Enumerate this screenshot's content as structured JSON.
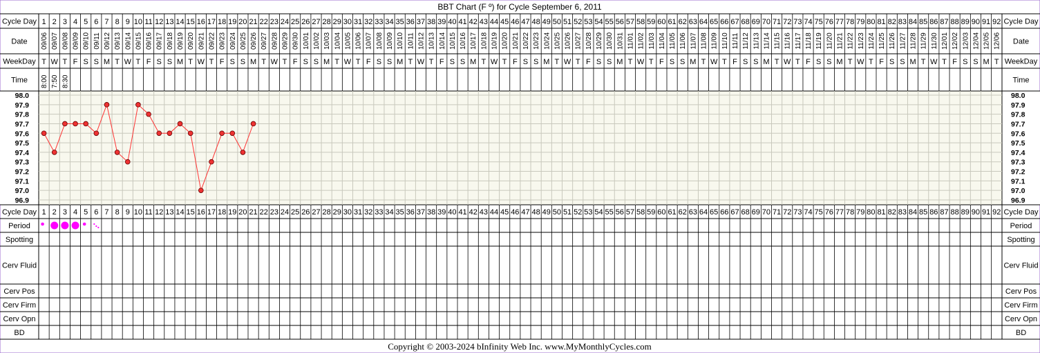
{
  "title": "BBT Chart (F º) for Cycle September 6, 2011",
  "row_labels": {
    "cycle_day": "Cycle Day",
    "date": "Date",
    "weekday": "WeekDay",
    "time": "Time",
    "period": "Period",
    "spotting": "Spotting",
    "cerv_fluid": "Cerv Fluid",
    "cerv_pos": "Cerv Pos",
    "cerv_firm": "Cerv Firm",
    "cerv_opn": "Cerv Opn",
    "bd": "BD"
  },
  "start_date": "2011-09-06",
  "num_days": 92,
  "weekday_letters": [
    "S",
    "M",
    "T",
    "W",
    "T",
    "F",
    "S"
  ],
  "times": [
    "8:00",
    "7:50",
    "8:30"
  ],
  "footer": "Copyright © 2003-2024 bInfinity Web Inc.      www.MyMonthlyCycles.com",
  "colors": {
    "border": "#9966cc",
    "line": "#ff3333",
    "point_fill": "#ee3333",
    "period": "#ff00ff",
    "grid_bg": "#f8f8ee",
    "header_bg": "#f0e6f8"
  },
  "chart_data": {
    "type": "line",
    "x_label": "Cycle Day",
    "y_ticks": [
      "98.0",
      "97.9",
      "97.8",
      "97.7",
      "97.6",
      "97.5",
      "97.4",
      "97.3",
      "97.2",
      "97.1",
      "97.0",
      "96.9"
    ],
    "ylim": [
      96.9,
      98.0
    ],
    "series": [
      {
        "x": [
          1,
          2,
          3,
          4,
          5,
          6,
          7,
          8,
          9,
          10,
          11,
          12,
          13,
          14,
          15,
          16,
          17,
          18,
          19,
          20,
          21
        ],
        "values": [
          97.6,
          97.4,
          97.7,
          97.7,
          97.7,
          97.6,
          97.9,
          97.4,
          97.3,
          97.9,
          97.8,
          97.6,
          97.6,
          97.7,
          97.6,
          97.0,
          97.3,
          97.6,
          97.6,
          97.4,
          97.7
        ]
      }
    ],
    "period": [
      {
        "day": 1,
        "level": "light"
      },
      {
        "day": 2,
        "level": "heavy"
      },
      {
        "day": 3,
        "level": "heavy"
      },
      {
        "day": 4,
        "level": "heavy"
      },
      {
        "day": 5,
        "level": "light"
      },
      {
        "day": 6,
        "level": "spotting"
      }
    ]
  }
}
